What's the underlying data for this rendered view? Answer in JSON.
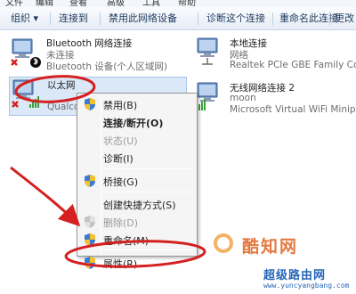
{
  "menubar": {
    "items": [
      "文件",
      "编辑",
      "查看",
      "高级",
      "工具",
      "帮助"
    ]
  },
  "toolbar": {
    "organize_label": "组织 ▾",
    "connect_to_label": "连接到",
    "disable_device_label": "禁用此网络设备",
    "diagnose_label": "诊断这个连接",
    "rename_label": "重命名此连接",
    "more_label": "更改"
  },
  "connections": [
    {
      "name": "Bluetooth 网络连接",
      "status": "未连接",
      "device": "Bluetooth 设备(个人区域网)"
    },
    {
      "name": "本地连接",
      "status": "网络",
      "device": "Realtek PCIe GBE Family Con"
    },
    {
      "name": "以太网",
      "status": "",
      "device": "Qualco"
    },
    {
      "name": "无线网络连接 2",
      "status": "moon",
      "device": "Microsoft Virtual WiFi Minipor"
    }
  ],
  "context_menu": {
    "items": [
      {
        "label": "禁用(B)",
        "style": "normal"
      },
      {
        "label": "连接/断开(O)",
        "style": "bold"
      },
      {
        "label": "状态(U)",
        "style": "disabled"
      },
      {
        "label": "诊断(I)",
        "style": "normal"
      },
      {
        "label": "桥接(G)",
        "style": "normal"
      },
      {
        "label": "创建快捷方式(S)",
        "style": "normal"
      },
      {
        "label": "删除(D)",
        "style": "disabled"
      },
      {
        "label": "重命名(M)",
        "style": "normal"
      },
      {
        "label": "属性(R)",
        "style": "normal"
      }
    ]
  },
  "watermark": {
    "brand_cn": "酷知网",
    "brand_cn2": "超级路由网",
    "url": "www.yuncyangbang.com"
  },
  "colors": {
    "annotation_red": "#d42020",
    "selection_bg": "#dbe8f8",
    "toolbar_text": "#1e395b"
  }
}
